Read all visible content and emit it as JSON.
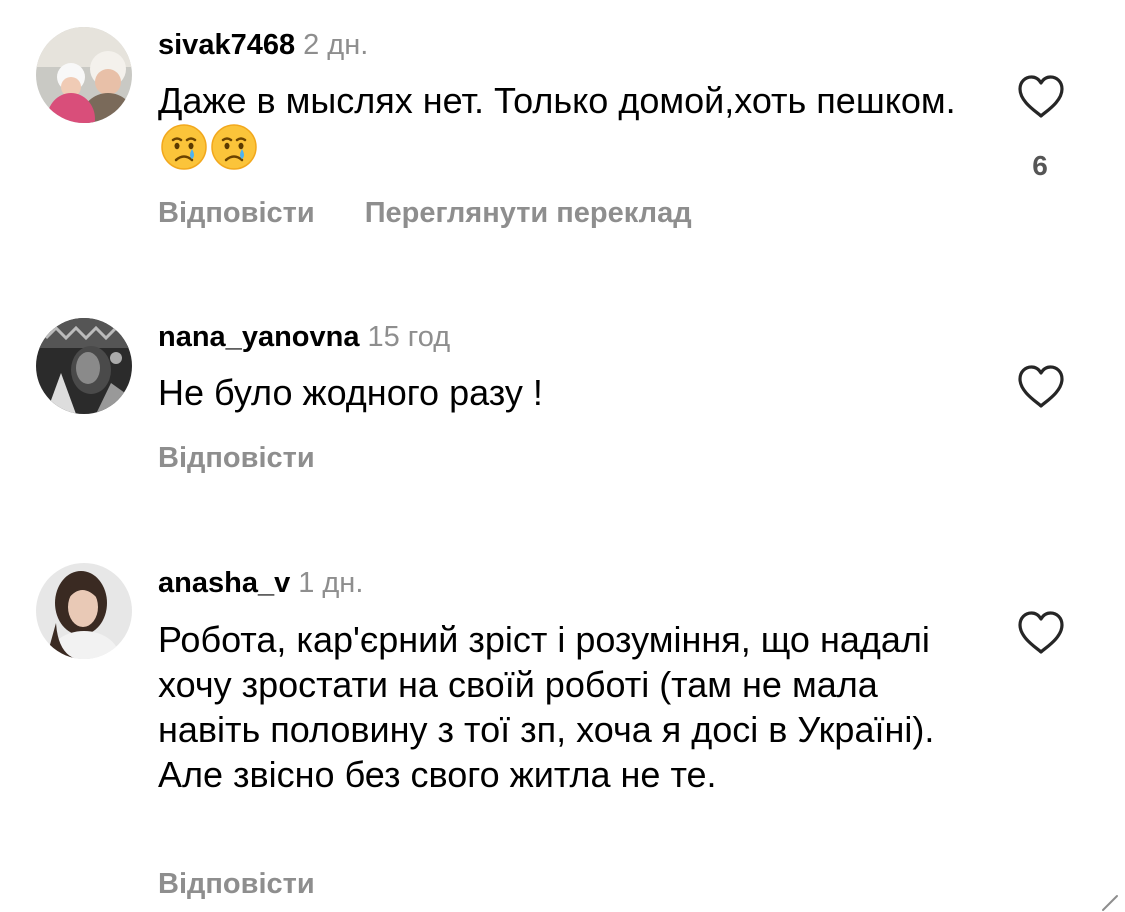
{
  "comments": [
    {
      "username": "sivak7468",
      "time": "2 дн.",
      "text": "Даже в мыслях нет. Только домой,хоть пешком.",
      "emojis": [
        "crying-face",
        "crying-face"
      ],
      "like_count": "6",
      "actions": {
        "reply": "Відповісти",
        "translate": "Переглянути переклад"
      }
    },
    {
      "username": "nana_yanovna",
      "time": "15 год",
      "text": "Не було жодного разу !",
      "actions": {
        "reply": "Відповісти"
      }
    },
    {
      "username": "anasha_v",
      "time": "1 дн.",
      "text": "Робота, кар'єрний зріст і розуміння, що надалі хочу зростати на своїй роботі (там не мала навіть половину з тої зп, хоча я досі в Україні). Але звісно без свого житла не те.",
      "actions": {
        "reply": "Відповісти"
      }
    }
  ],
  "colors": {
    "secondary_text": "#8e8e8e",
    "primary_text": "#000000",
    "background": "#ffffff"
  }
}
